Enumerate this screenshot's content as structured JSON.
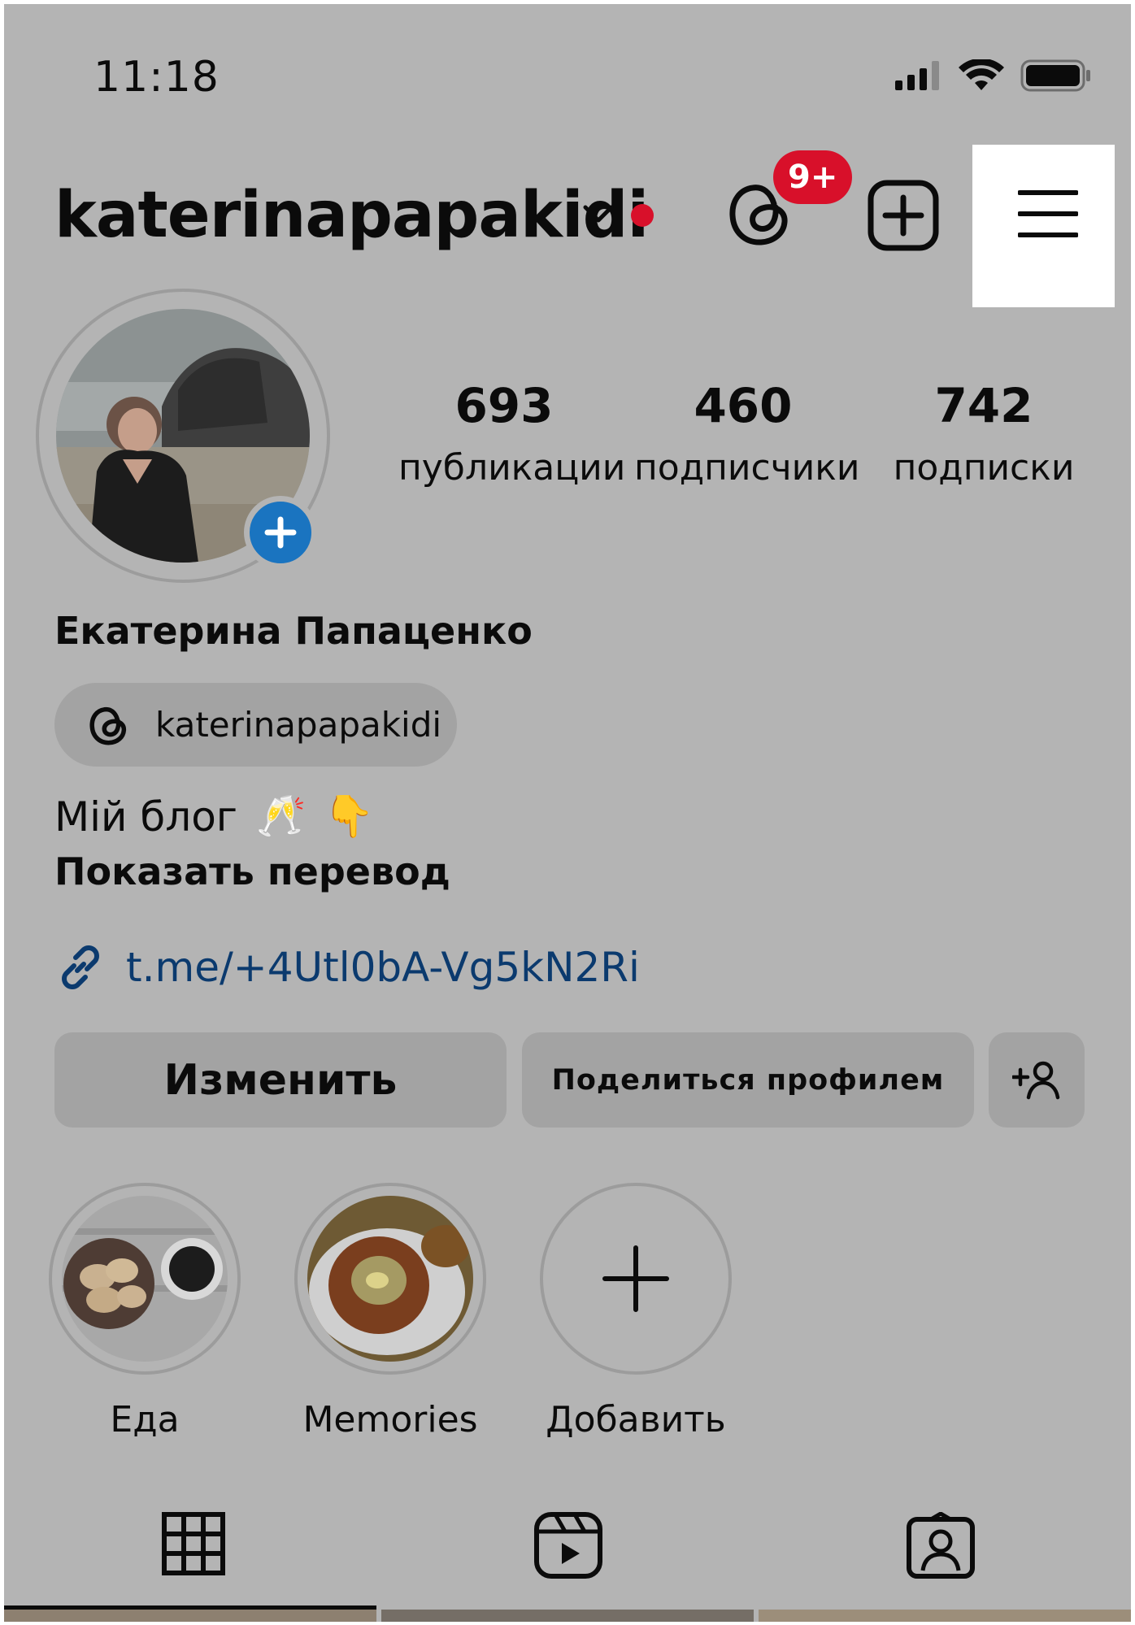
{
  "status_bar": {
    "time": "11:18"
  },
  "header": {
    "username": "katerinapapakidi",
    "threads_badge": "9+",
    "icons": [
      "chevron-down-icon",
      "threads-icon",
      "create-post-icon",
      "hamburger-menu-icon"
    ]
  },
  "profile": {
    "stats": [
      {
        "value": "693",
        "label": "публикации"
      },
      {
        "value": "460",
        "label": "подписчики"
      },
      {
        "value": "742",
        "label": "подписки"
      }
    ],
    "full_name": "Екатерина Папаценко",
    "threads_handle": "katerinapapakidi",
    "bio": "Мій блог",
    "bio_emoji": [
      "🥂",
      "👇"
    ],
    "translate_link": "Показать перевод",
    "link": "t.me/+4Utl0bA-Vg5kN2Ri"
  },
  "actions": {
    "edit_label": "Изменить",
    "share_label": "Поделиться профилем"
  },
  "highlights": [
    {
      "label": "Еда"
    },
    {
      "label": "Memories"
    },
    {
      "label": "Добавить"
    }
  ],
  "tabs": [
    "grid-icon",
    "reels-icon",
    "tagged-icon"
  ],
  "colors": {
    "badge": "#d8102a",
    "accent": "#1a74c0",
    "link": "#0b3a6e",
    "overlay": "#b4b4b4",
    "button": "#a3a3a3"
  }
}
